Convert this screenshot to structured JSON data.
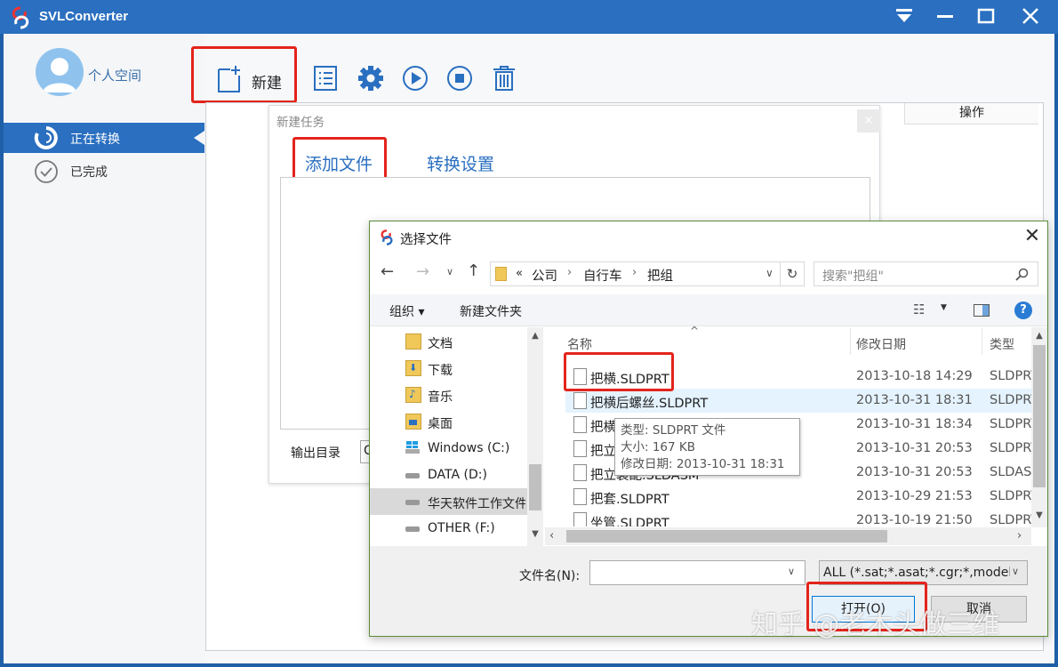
{
  "app": {
    "title": "SVLConverter",
    "user_label": "个人空间",
    "accent": "#2a6fc0"
  },
  "window_controls": [
    "menu-down-icon",
    "minimize-icon",
    "maximize-icon",
    "close-icon"
  ],
  "toolbar": {
    "new_label": "新建",
    "icons": [
      "new-file-icon",
      "list-icon",
      "gear-icon",
      "play-icon",
      "stop-icon",
      "trash-icon"
    ]
  },
  "sidebar": {
    "items": [
      {
        "label": "正在转换",
        "icon": "sync-icon",
        "active": true
      },
      {
        "label": "已完成",
        "icon": "check-circle-icon",
        "active": false
      }
    ]
  },
  "table": {
    "header_action": "操作"
  },
  "new_task": {
    "title": "新建任务",
    "tabs": [
      {
        "label": "添加文件",
        "active": true
      },
      {
        "label": "转换设置",
        "active": false
      }
    ],
    "output_label": "输出目录",
    "output_value": "C"
  },
  "file_dialog": {
    "title": "选择文件",
    "breadcrumb": {
      "prefix": "«",
      "parts": [
        "公司",
        "自行车",
        "把组"
      ]
    },
    "search_placeholder": "搜索\"把组\"",
    "toolbar": {
      "organize": "组织 ▾",
      "new_folder": "新建文件夹"
    },
    "nav": [
      {
        "label": "文档",
        "icon": "documents-folder-icon"
      },
      {
        "label": "下载",
        "icon": "downloads-folder-icon"
      },
      {
        "label": "音乐",
        "icon": "music-folder-icon"
      },
      {
        "label": "桌面",
        "icon": "desktop-folder-icon"
      },
      {
        "label": "Windows (C:)",
        "icon": "windows-drive-icon"
      },
      {
        "label": "DATA (D:)",
        "icon": "drive-icon"
      },
      {
        "label": "华天软件工作文件",
        "icon": "drive-icon",
        "selected": true
      },
      {
        "label": "OTHER (F:)",
        "icon": "drive-icon"
      }
    ],
    "columns": [
      "名称",
      "修改日期",
      "类型"
    ],
    "files": [
      {
        "name": "把横.SLDPRT",
        "date": "2013-10-18 14:29",
        "type": "SLDPRT"
      },
      {
        "name": "把横后螺丝.SLDPRT",
        "date": "2013-10-31 18:31",
        "type": "SLDPRT"
      },
      {
        "name": "把横前螺丝.SLDPRT",
        "date": "2013-10-31 18:34",
        "type": "SLDPRT"
      },
      {
        "name": "把立.SLDPRT",
        "date": "2013-10-31 20:53",
        "type": "SLDPRT"
      },
      {
        "name": "把立装配.SLDASM",
        "date": "2013-10-31 20:53",
        "type": "SLDASM"
      },
      {
        "name": "把套.SLDPRT",
        "date": "2013-10-29 21:53",
        "type": "SLDPRT"
      },
      {
        "name": "坐管.SLDPRT",
        "date": "2013-10-19 21:50",
        "type": "SLDPRT"
      }
    ],
    "tooltip": {
      "type_line": "类型: SLDPRT 文件",
      "size_line": "大小: 167 KB",
      "date_line": "修改日期: 2013-10-31 18:31"
    },
    "filename_label": "文件名(N):",
    "filename_value": "",
    "filter_value": "ALL (*.sat;*.asat;*.cgr;*,model",
    "open_label": "打开(O)",
    "cancel_label": "取消"
  },
  "watermark": "知乎 @老木头做三维"
}
